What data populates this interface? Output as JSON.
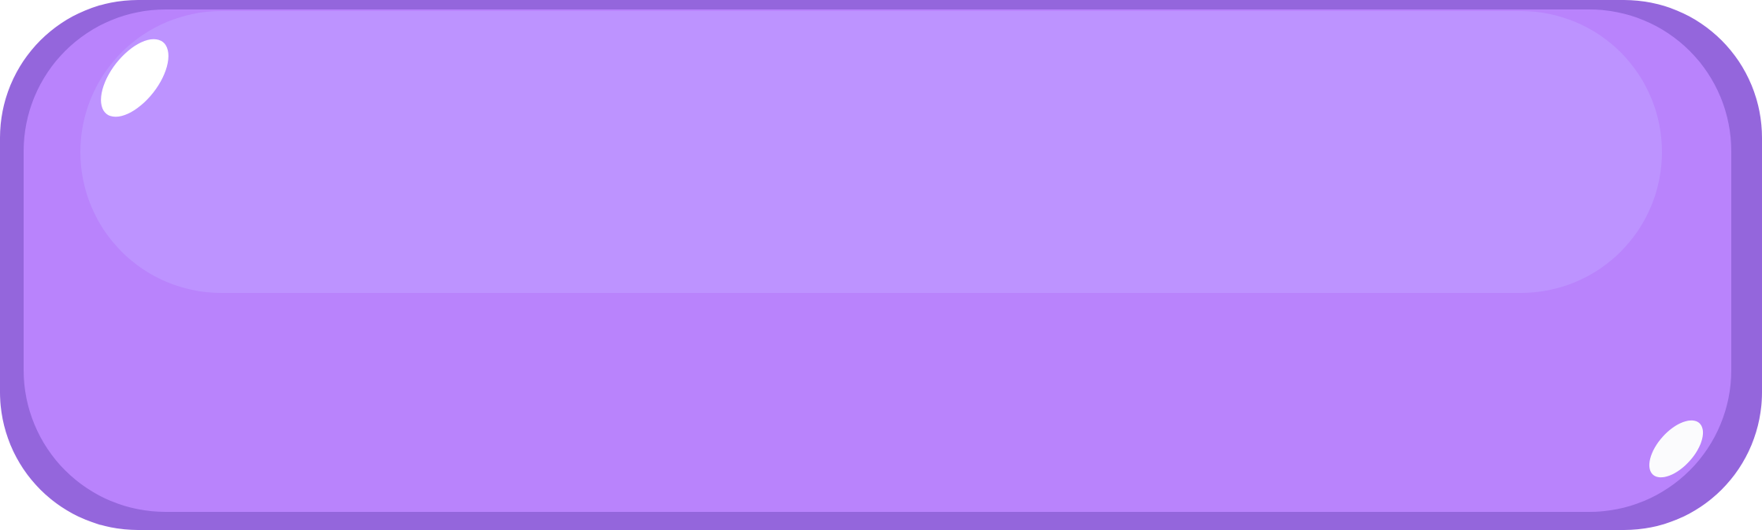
{
  "button": {
    "label": "",
    "colors": {
      "outer_rim": "#9466dc",
      "body": "#b983fc",
      "gloss": "#bd93ff",
      "highlight": "#ffffff"
    },
    "icons": {
      "top_left_shine": "shine-highlight",
      "bottom_right_shine": "shine-highlight"
    }
  }
}
